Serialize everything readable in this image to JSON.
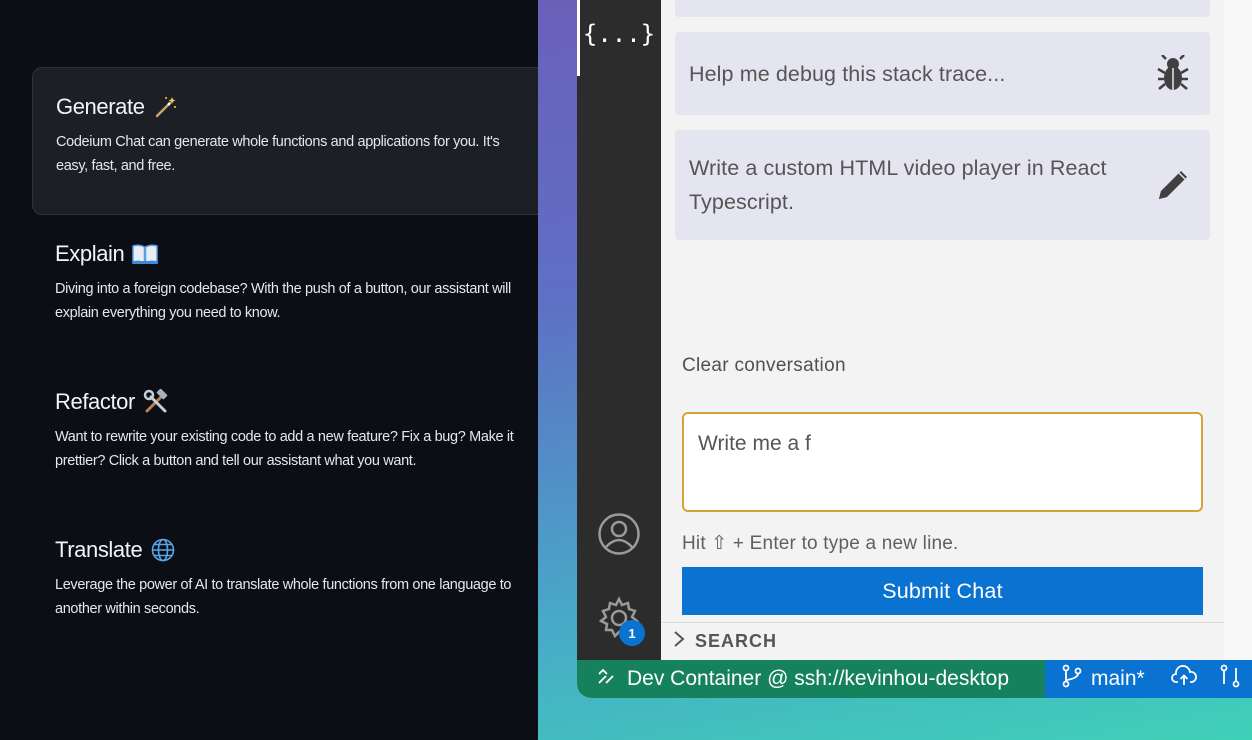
{
  "features": [
    {
      "title": "Generate",
      "icon": "magic-wand-icon",
      "description": "Codeium Chat can generate whole functions and applications for you. It's easy, fast, and free."
    },
    {
      "title": "Explain",
      "icon": "open-book-icon",
      "description": "Diving into a foreign codebase? With the push of a button, our assistant will explain everything you need to know."
    },
    {
      "title": "Refactor",
      "icon": "hammer-wrench-icon",
      "description": "Want to rewrite your existing code to add a new feature? Fix a bug? Make it prettier? Click a button and tell our assistant what you want."
    },
    {
      "title": "Translate",
      "icon": "globe-icon",
      "description": "Leverage the power of AI to translate whole functions from one language to another within seconds."
    }
  ],
  "activity_bar": {
    "top_icon_text": "{...}",
    "settings_badge": "1"
  },
  "chat": {
    "suggestions": [
      {
        "text": "Help me debug this stack trace...",
        "icon": "bug-icon"
      },
      {
        "text": "Write a custom HTML video player in React Typescript.",
        "icon": "pencil-icon"
      }
    ],
    "clear_label": "Clear conversation",
    "input_value": "Write me a f",
    "hint": "Hit ⇧ + Enter to type a new line.",
    "submit_label": "Submit Chat",
    "search_section": "SEARCH"
  },
  "status_bar": {
    "remote_label": "Dev Container @ ssh://kevinhou-desktop",
    "branch": "main*"
  },
  "colors": {
    "accent_blue": "#0a72d0",
    "remote_green": "#16825d",
    "input_border": "#d6a33a"
  }
}
